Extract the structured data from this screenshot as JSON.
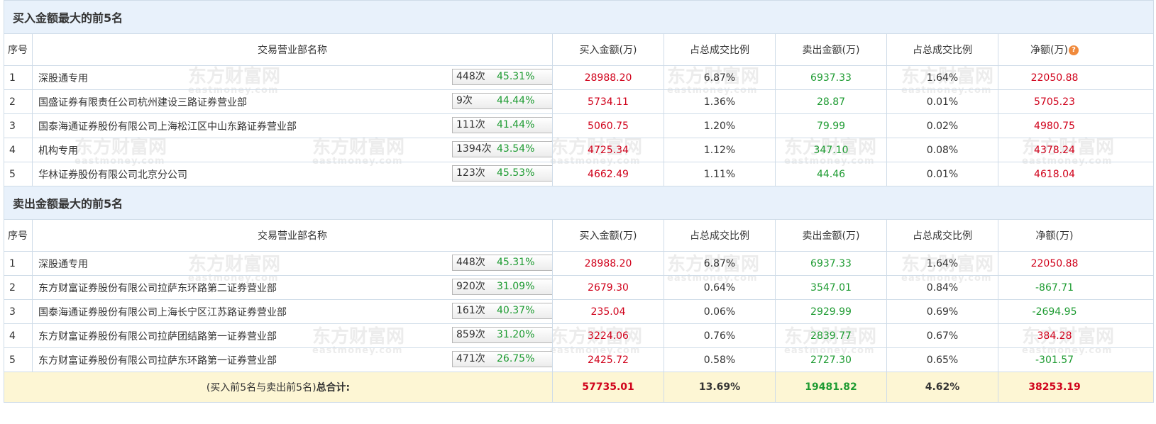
{
  "watermark": {
    "text": "东方财富网",
    "sub": "eastmoney.com"
  },
  "columns": {
    "no": "序号",
    "name": "交易营业部名称",
    "buy": "买入金额(万)",
    "buy_ratio": "占总成交比例",
    "sell": "卖出金额(万)",
    "sell_ratio": "占总成交比例",
    "net": "净额(万)",
    "help": "?"
  },
  "buy_top5": {
    "title": "买入金额最大的前5名",
    "rows": [
      {
        "no": "1",
        "name": "深股通专用",
        "count": "448次",
        "rate": "45.31%",
        "icon": "question-icon",
        "buy": "28988.20",
        "buy_ratio": "6.87%",
        "sell": "6937.33",
        "sell_ratio": "1.64%",
        "net": "22050.88"
      },
      {
        "no": "2",
        "name": "国盛证券有限责任公司杭州建设三路证券营业部",
        "count": "9次",
        "rate": "44.44%",
        "icon": "play-icon",
        "buy": "5734.11",
        "buy_ratio": "1.36%",
        "sell": "28.87",
        "sell_ratio": "0.01%",
        "net": "5705.23"
      },
      {
        "no": "3",
        "name": "国泰海通证券股份有限公司上海松江区中山东路证券营业部",
        "count": "111次",
        "rate": "41.44%",
        "icon": "play-icon",
        "buy": "5060.75",
        "buy_ratio": "1.20%",
        "sell": "79.99",
        "sell_ratio": "0.02%",
        "net": "4980.75"
      },
      {
        "no": "4",
        "name": "机构专用",
        "count": "1394次",
        "rate": "43.54%",
        "icon": "play-icon",
        "buy": "4725.34",
        "buy_ratio": "1.12%",
        "sell": "347.10",
        "sell_ratio": "0.08%",
        "net": "4378.24"
      },
      {
        "no": "5",
        "name": "华林证券股份有限公司北京分公司",
        "count": "123次",
        "rate": "45.53%",
        "icon": "play-icon",
        "buy": "4662.49",
        "buy_ratio": "1.11%",
        "sell": "44.46",
        "sell_ratio": "0.01%",
        "net": "4618.04"
      }
    ]
  },
  "sell_top5": {
    "title": "卖出金额最大的前5名",
    "rows": [
      {
        "no": "1",
        "name": "深股通专用",
        "count": "448次",
        "rate": "45.31%",
        "icon": "question-icon",
        "buy": "28988.20",
        "buy_ratio": "6.87%",
        "sell": "6937.33",
        "sell_ratio": "1.64%",
        "net": "22050.88"
      },
      {
        "no": "2",
        "name": "东方财富证券股份有限公司拉萨东环路第二证券营业部",
        "count": "920次",
        "rate": "31.09%",
        "icon": "play-icon",
        "buy": "2679.30",
        "buy_ratio": "0.64%",
        "sell": "3547.01",
        "sell_ratio": "0.84%",
        "net": "-867.71"
      },
      {
        "no": "3",
        "name": "国泰海通证券股份有限公司上海长宁区江苏路证券营业部",
        "count": "161次",
        "rate": "40.37%",
        "icon": "play-icon",
        "buy": "235.04",
        "buy_ratio": "0.06%",
        "sell": "2929.99",
        "sell_ratio": "0.69%",
        "net": "-2694.95"
      },
      {
        "no": "4",
        "name": "东方财富证券股份有限公司拉萨团结路第一证券营业部",
        "count": "859次",
        "rate": "31.20%",
        "icon": "play-icon",
        "buy": "3224.06",
        "buy_ratio": "0.76%",
        "sell": "2839.77",
        "sell_ratio": "0.67%",
        "net": "384.28"
      },
      {
        "no": "5",
        "name": "东方财富证券股份有限公司拉萨东环路第一证券营业部",
        "count": "471次",
        "rate": "26.75%",
        "icon": "play-icon",
        "buy": "2425.72",
        "buy_ratio": "0.58%",
        "sell": "2727.30",
        "sell_ratio": "0.65%",
        "net": "-301.57"
      }
    ]
  },
  "total": {
    "label_prefix": "(买入前5名与卖出前5名)",
    "label_bold": "总合计:",
    "buy": "57735.01",
    "buy_ratio": "13.69%",
    "sell": "19481.82",
    "sell_ratio": "4.62%",
    "net": "38253.19"
  },
  "colors": {
    "positive": "#d0021b",
    "buy_green": "#1e9b32",
    "header_bg": "#e8f1fb",
    "total_bg": "#fdf6d4"
  }
}
